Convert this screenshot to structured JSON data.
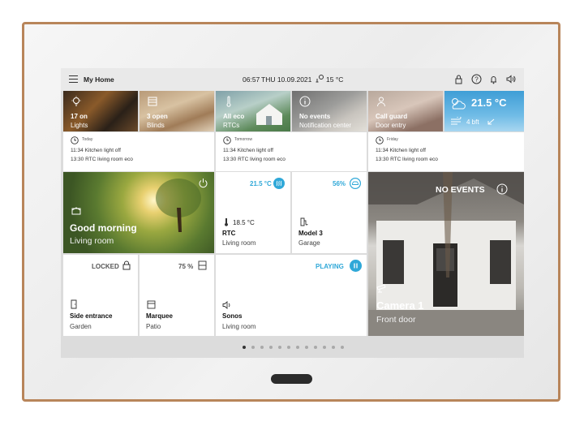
{
  "status_bar": {
    "home_title": "My Home",
    "time": "06:57",
    "date": "THU 10.09.2021",
    "temperature": "15 °C"
  },
  "top_tiles": [
    {
      "value": "17 on",
      "label": "Lights"
    },
    {
      "value": "3 open",
      "label": "Blinds"
    },
    {
      "value": "All eco",
      "label": "RTCs"
    },
    {
      "value": "No events",
      "label": "Notification center"
    },
    {
      "value": "Call guard",
      "label": "Door entry"
    },
    {
      "value": "21.5 °C",
      "label": "4 bft"
    }
  ],
  "history": [
    {
      "day": "Today",
      "line1": "11:34 Kitchen light off",
      "line2": "13:30 RTC living room eco"
    },
    {
      "day": "Tomorrow",
      "line1": "11:34 Kitchen light off",
      "line2": "13:30 RTC living room eco"
    },
    {
      "day": "Friday",
      "line1": "11:34 Kitchen light off",
      "line2": "13:30 RTC living room eco"
    }
  ],
  "scene_tile": {
    "title": "Good morning",
    "subtitle": "Living room"
  },
  "rtc_tile": {
    "setpoint": "21.5 °C",
    "current": "18.5 °C",
    "name": "RTC",
    "room": "Living room"
  },
  "garage_tile": {
    "value": "56%",
    "name": "Model 3",
    "room": "Garage"
  },
  "camera_tile": {
    "events": "NO EVENTS",
    "name": "Camera 1",
    "location": "Front door"
  },
  "door_tile": {
    "state": "LOCKED",
    "name": "Side entrance",
    "room": "Garden"
  },
  "marquee_tile": {
    "value": "75 %",
    "name": "Marquee",
    "room": "Patio"
  },
  "sonos_tile": {
    "state": "PLAYING",
    "name": "Sonos",
    "room": "Living room"
  },
  "pagination": {
    "total": 12,
    "active": 1
  },
  "colors": {
    "accent": "#2fa8d8",
    "frame": "#b8855a",
    "background": "#dcdcdc"
  }
}
